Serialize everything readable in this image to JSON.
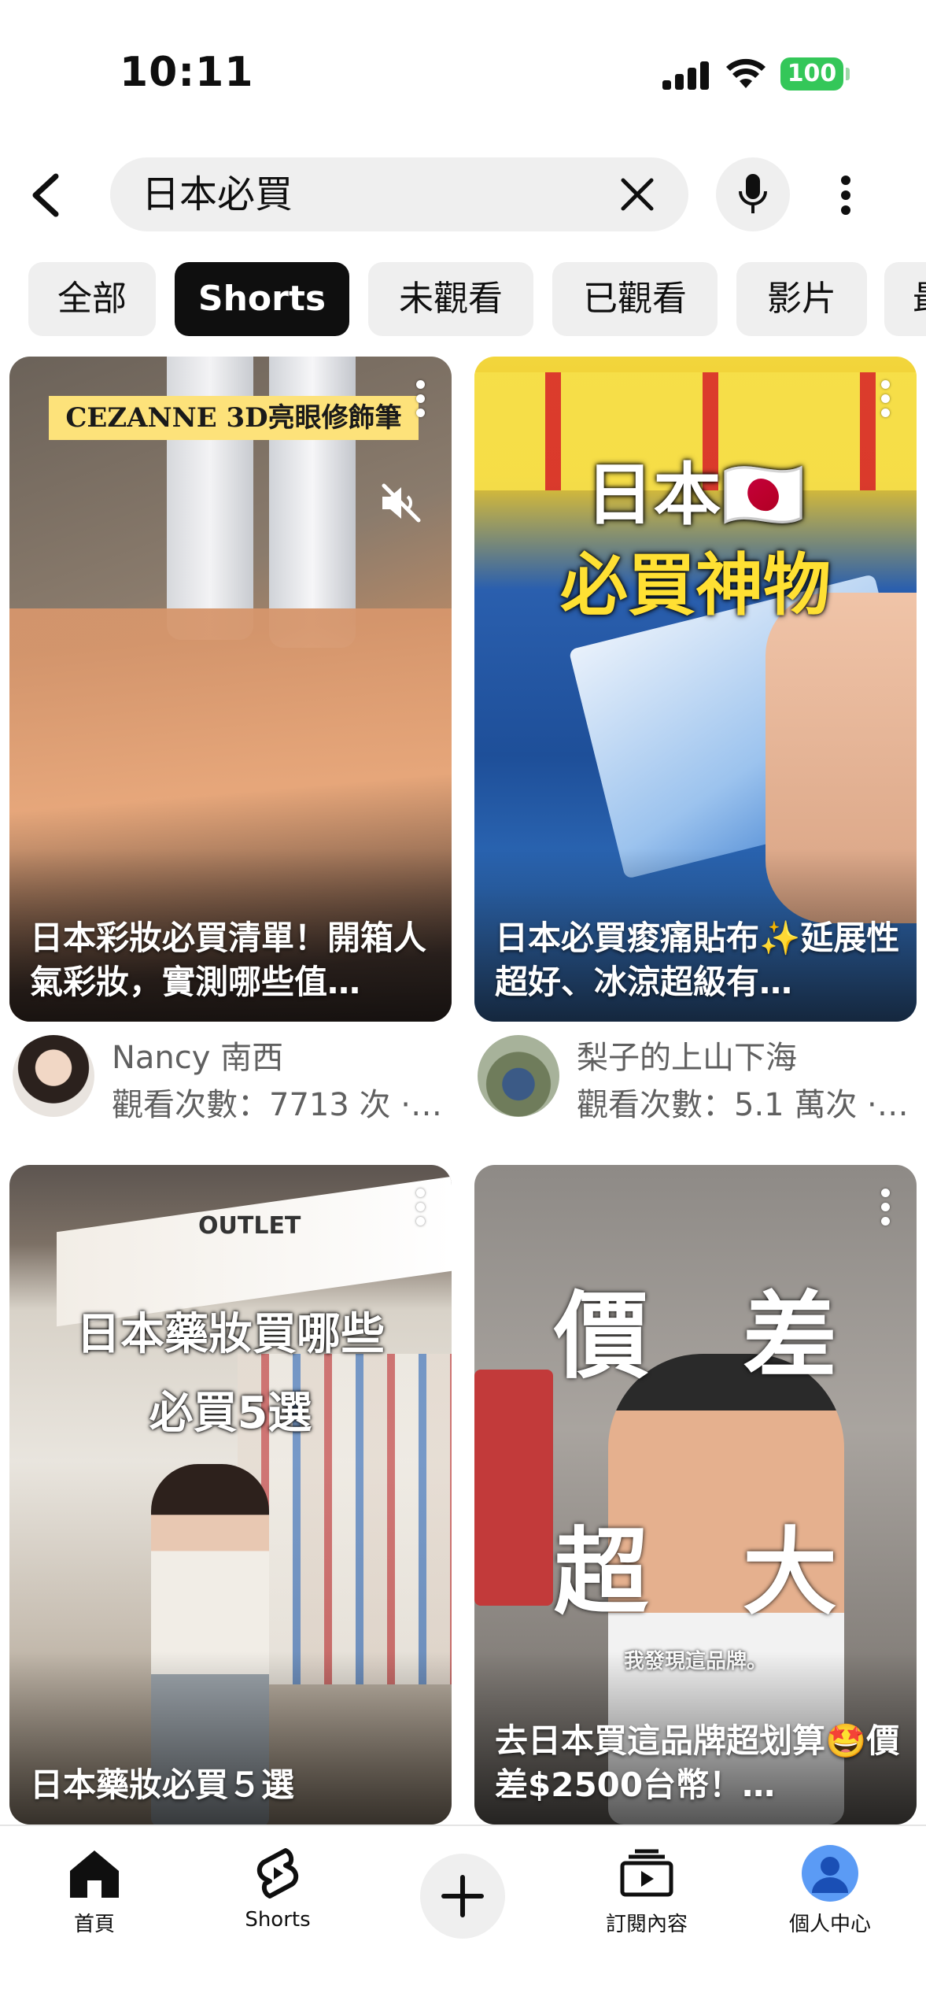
{
  "status_bar": {
    "time": "10:11",
    "battery": "100"
  },
  "search": {
    "query": "日本必買"
  },
  "chips": [
    "全部",
    "Shorts",
    "未觀看",
    "已觀看",
    "影片",
    "最"
  ],
  "active_chip": "Shorts",
  "cards": [
    {
      "title": "日本彩妝必買清單！開箱人氣彩妝，實測哪些值…",
      "overlay": "CEZANNE 3D亮眼修飾筆",
      "channel": "Nancy 南西",
      "views": "觀看次數：7713 次 ·…"
    },
    {
      "title": "日本必買痠痛貼布✨延展性超好、冰涼超級有…",
      "overlay_line1": "日本🇯🇵",
      "overlay_line2": "必買神物",
      "channel": "梨子的上山下海",
      "views": "觀看次數：5.1 萬次 ·…"
    },
    {
      "title": "日本藥妝必買５選",
      "overlay_line1": "日本藥妝買哪些",
      "overlay_line2": "必買5選",
      "sign_text": "OUTLET"
    },
    {
      "title": "去日本買這品牌超划算🤩價差$2500台幣！…",
      "overlay_line1": "價　差",
      "overlay_line2": "超　大",
      "caption": "我發現這品牌。"
    }
  ],
  "bottom_nav": {
    "home": "首頁",
    "shorts": "Shorts",
    "subscriptions": "訂閱內容",
    "you": "個人中心"
  },
  "colors": {
    "accent": "#0f0f0f",
    "chip_bg": "#efefef",
    "battery": "#34c759"
  }
}
